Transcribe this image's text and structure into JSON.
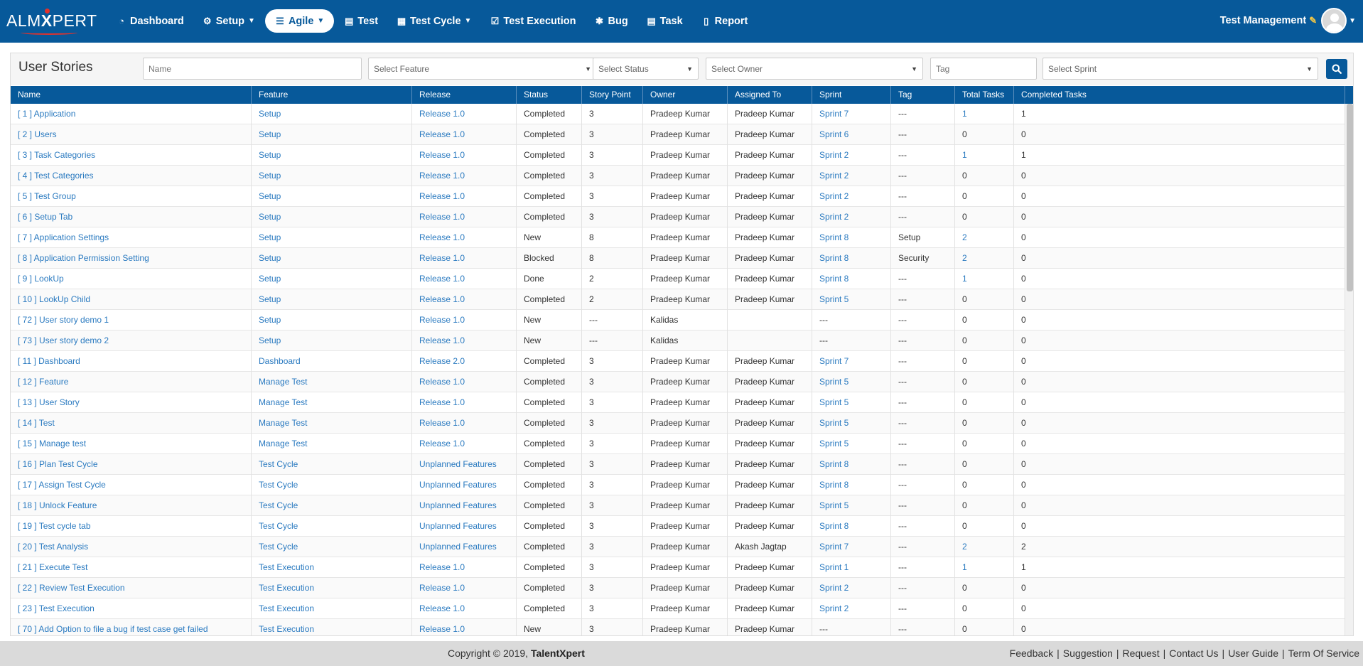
{
  "logo": {
    "pre": "ALM",
    "x": "X",
    "post": "PERT"
  },
  "nav": [
    {
      "label": "Dashboard",
      "icon": "dashboard-icon",
      "caret": false,
      "active": false
    },
    {
      "label": "Setup",
      "icon": "cogs-icon",
      "caret": true,
      "active": false
    },
    {
      "label": "Agile",
      "icon": "list-icon",
      "caret": true,
      "active": true
    },
    {
      "label": "Test",
      "icon": "file-icon",
      "caret": false,
      "active": false
    },
    {
      "label": "Test Cycle",
      "icon": "table-icon",
      "caret": true,
      "active": false
    },
    {
      "label": "Test Execution",
      "icon": "check-square-icon",
      "caret": false,
      "active": false
    },
    {
      "label": "Bug",
      "icon": "bug-icon",
      "caret": false,
      "active": false
    },
    {
      "label": "Task",
      "icon": "tasks-icon",
      "caret": false,
      "active": false
    },
    {
      "label": "Report",
      "icon": "report-icon",
      "caret": false,
      "active": false
    }
  ],
  "user": {
    "label": "Test Management"
  },
  "page": {
    "title": "User Stories"
  },
  "filters": {
    "name_placeholder": "Name",
    "feature": "Select Feature",
    "status": "Select Status",
    "owner": "Select Owner",
    "tag_placeholder": "Tag",
    "sprint": "Select Sprint"
  },
  "columns": [
    "Name",
    "Feature",
    "Release",
    "Status",
    "Story Point",
    "Owner",
    "Assigned To",
    "Sprint",
    "Tag",
    "Total Tasks",
    "Completed Tasks"
  ],
  "rows": [
    [
      "[ 1 ] Application",
      "Setup",
      "Release 1.0",
      "Completed",
      "3",
      "Pradeep Kumar",
      "Pradeep Kumar",
      "Sprint 7",
      "---",
      "1",
      "1"
    ],
    [
      "[ 2 ] Users",
      "Setup",
      "Release 1.0",
      "Completed",
      "3",
      "Pradeep Kumar",
      "Pradeep Kumar",
      "Sprint 6",
      "---",
      "0",
      "0"
    ],
    [
      "[ 3 ] Task Categories",
      "Setup",
      "Release 1.0",
      "Completed",
      "3",
      "Pradeep Kumar",
      "Pradeep Kumar",
      "Sprint 2",
      "---",
      "1",
      "1"
    ],
    [
      "[ 4 ] Test Categories",
      "Setup",
      "Release 1.0",
      "Completed",
      "3",
      "Pradeep Kumar",
      "Pradeep Kumar",
      "Sprint 2",
      "---",
      "0",
      "0"
    ],
    [
      "[ 5 ] Test Group",
      "Setup",
      "Release 1.0",
      "Completed",
      "3",
      "Pradeep Kumar",
      "Pradeep Kumar",
      "Sprint 2",
      "---",
      "0",
      "0"
    ],
    [
      "[ 6 ] Setup Tab",
      "Setup",
      "Release 1.0",
      "Completed",
      "3",
      "Pradeep Kumar",
      "Pradeep Kumar",
      "Sprint 2",
      "---",
      "0",
      "0"
    ],
    [
      "[ 7 ] Application Settings",
      "Setup",
      "Release 1.0",
      "New",
      "8",
      "Pradeep Kumar",
      "Pradeep Kumar",
      "Sprint 8",
      "Setup",
      "2",
      "0"
    ],
    [
      "[ 8 ] Application Permission Setting",
      "Setup",
      "Release 1.0",
      "Blocked",
      "8",
      "Pradeep Kumar",
      "Pradeep Kumar",
      "Sprint 8",
      "Security",
      "2",
      "0"
    ],
    [
      "[ 9 ] LookUp",
      "Setup",
      "Release 1.0",
      "Done",
      "2",
      "Pradeep Kumar",
      "Pradeep Kumar",
      "Sprint 8",
      "---",
      "1",
      "0"
    ],
    [
      "[ 10 ] LookUp Child",
      "Setup",
      "Release 1.0",
      "Completed",
      "2",
      "Pradeep Kumar",
      "Pradeep Kumar",
      "Sprint 5",
      "---",
      "0",
      "0"
    ],
    [
      "[ 72 ] User story demo 1",
      "Setup",
      "Release 1.0",
      "New",
      "---",
      "Kalidas",
      "",
      "---",
      "---",
      "0",
      "0"
    ],
    [
      "[ 73 ] User story demo 2",
      "Setup",
      "Release 1.0",
      "New",
      "---",
      "Kalidas",
      "",
      "---",
      "---",
      "0",
      "0"
    ],
    [
      "[ 11 ] Dashboard",
      "Dashboard",
      "Release 2.0",
      "Completed",
      "3",
      "Pradeep Kumar",
      "Pradeep Kumar",
      "Sprint 7",
      "---",
      "0",
      "0"
    ],
    [
      "[ 12 ] Feature",
      "Manage Test",
      "Release 1.0",
      "Completed",
      "3",
      "Pradeep Kumar",
      "Pradeep Kumar",
      "Sprint 5",
      "---",
      "0",
      "0"
    ],
    [
      "[ 13 ] User Story",
      "Manage Test",
      "Release 1.0",
      "Completed",
      "3",
      "Pradeep Kumar",
      "Pradeep Kumar",
      "Sprint 5",
      "---",
      "0",
      "0"
    ],
    [
      "[ 14 ] Test",
      "Manage Test",
      "Release 1.0",
      "Completed",
      "3",
      "Pradeep Kumar",
      "Pradeep Kumar",
      "Sprint 5",
      "---",
      "0",
      "0"
    ],
    [
      "[ 15 ] Manage test",
      "Manage Test",
      "Release 1.0",
      "Completed",
      "3",
      "Pradeep Kumar",
      "Pradeep Kumar",
      "Sprint 5",
      "---",
      "0",
      "0"
    ],
    [
      "[ 16 ] Plan Test Cycle",
      "Test Cycle",
      "Unplanned Features",
      "Completed",
      "3",
      "Pradeep Kumar",
      "Pradeep Kumar",
      "Sprint 8",
      "---",
      "0",
      "0"
    ],
    [
      "[ 17 ] Assign Test Cycle",
      "Test Cycle",
      "Unplanned Features",
      "Completed",
      "3",
      "Pradeep Kumar",
      "Pradeep Kumar",
      "Sprint 8",
      "---",
      "0",
      "0"
    ],
    [
      "[ 18 ] Unlock Feature",
      "Test Cycle",
      "Unplanned Features",
      "Completed",
      "3",
      "Pradeep Kumar",
      "Pradeep Kumar",
      "Sprint 5",
      "---",
      "0",
      "0"
    ],
    [
      "[ 19 ] Test cycle tab",
      "Test Cycle",
      "Unplanned Features",
      "Completed",
      "3",
      "Pradeep Kumar",
      "Pradeep Kumar",
      "Sprint 8",
      "---",
      "0",
      "0"
    ],
    [
      "[ 20 ] Test Analysis",
      "Test Cycle",
      "Unplanned Features",
      "Completed",
      "3",
      "Pradeep Kumar",
      "Akash Jagtap",
      "Sprint 7",
      "---",
      "2",
      "2"
    ],
    [
      "[ 21 ] Execute Test",
      "Test Execution",
      "Release 1.0",
      "Completed",
      "3",
      "Pradeep Kumar",
      "Pradeep Kumar",
      "Sprint 1",
      "---",
      "1",
      "1"
    ],
    [
      "[ 22 ] Review Test Execution",
      "Test Execution",
      "Release 1.0",
      "Completed",
      "3",
      "Pradeep Kumar",
      "Pradeep Kumar",
      "Sprint 2",
      "---",
      "0",
      "0"
    ],
    [
      "[ 23 ] Test Execution",
      "Test Execution",
      "Release 1.0",
      "Completed",
      "3",
      "Pradeep Kumar",
      "Pradeep Kumar",
      "Sprint 2",
      "---",
      "0",
      "0"
    ],
    [
      "[ 70 ] Add Option to file a bug if test case get failed",
      "Test Execution",
      "Release 1.0",
      "New",
      "3",
      "Pradeep Kumar",
      "Pradeep Kumar",
      "---",
      "---",
      "0",
      "0"
    ]
  ],
  "footer": {
    "copyright": "Copyright © 2019,",
    "brand": "TalentXpert",
    "links": [
      "Feedback",
      "Suggestion",
      "Request",
      "Contact Us",
      "User Guide",
      "Term Of Service"
    ]
  },
  "colors": {
    "primary": "#07599a",
    "link": "#2a7ac0",
    "footer_bg": "#dadada"
  }
}
